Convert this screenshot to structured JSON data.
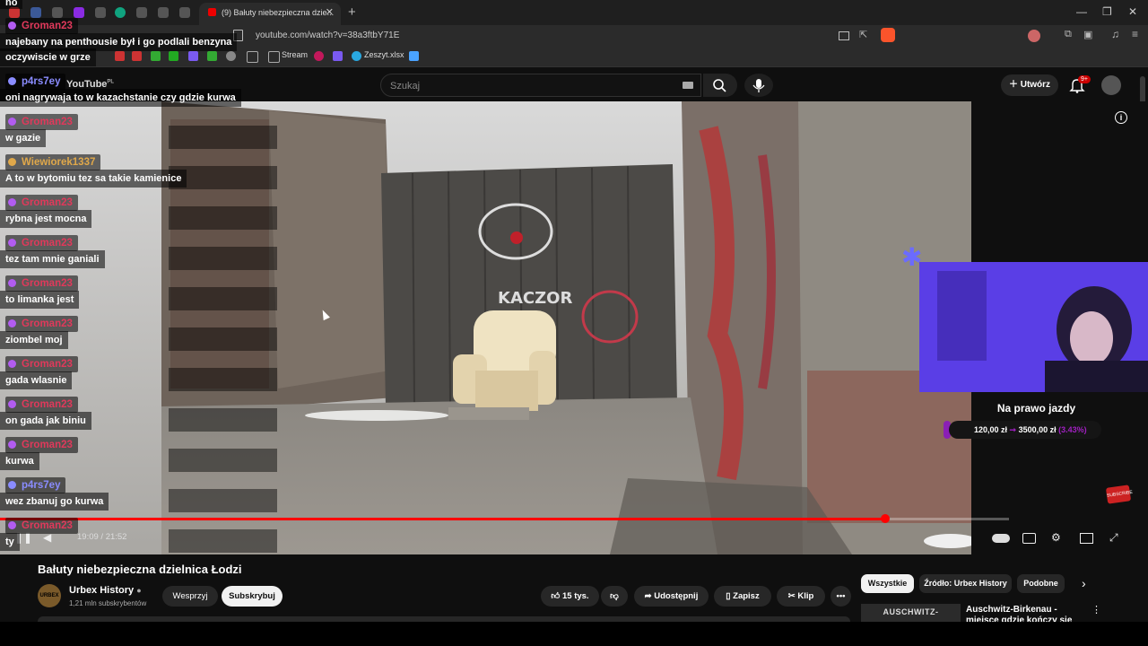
{
  "browser": {
    "active_tab_title": "(9) Bałuty niebezpieczna dzie...",
    "url": "youtube.com/watch?v=38a3ftbY71E",
    "bookmarks": [
      "Stream",
      "Zeszyt.xlsx"
    ]
  },
  "youtube": {
    "logo_text": "YouTube",
    "logo_region": "PL",
    "search_placeholder": "Szukaj",
    "create_label": "Utwórz",
    "notif_count": "9+"
  },
  "chat": {
    "top_fragment": "no",
    "messages": [
      {
        "user": "Groman23",
        "text": "najebany na penthousie był i go podlali benzyna",
        "user_color": "#e0395b"
      },
      {
        "user": "",
        "text": "oczywiscie w grze",
        "user_color": ""
      },
      {
        "user": "p4rs7ey",
        "text": "oni nagrywaja to w kazachstanie czy gdzie kurwa",
        "user_color": "#8a8cff"
      },
      {
        "user": "Groman23",
        "text": "w gazie",
        "user_color": "#e0395b"
      },
      {
        "user": "Wiewiorek1337",
        "text": "A to w bytomiu tez sa takie kamienice",
        "user_color": "#e0a84a"
      },
      {
        "user": "Groman23",
        "text": "rybna jest mocna",
        "user_color": "#e0395b"
      },
      {
        "user": "Groman23",
        "text": "tez tam mnie ganiali",
        "user_color": "#e0395b"
      },
      {
        "user": "Groman23",
        "text": "to limanka jest",
        "user_color": "#e0395b"
      },
      {
        "user": "Groman23",
        "text": "ziombel moj",
        "user_color": "#e0395b"
      },
      {
        "user": "Groman23",
        "text": "gada wlasnie",
        "user_color": "#e0395b"
      },
      {
        "user": "Groman23",
        "text": "on gada jak biniu",
        "user_color": "#e0395b"
      },
      {
        "user": "Groman23",
        "text": "kurwa",
        "user_color": "#e0395b"
      },
      {
        "user": "p4rs7ey",
        "text": "wez zbanuj go kurwa",
        "user_color": "#8a8cff"
      },
      {
        "user": "Groman23",
        "text": "ty",
        "user_color": "#e0395b"
      }
    ]
  },
  "player": {
    "time": "19:09 / 21:52",
    "progress": 0.877
  },
  "overlay": {
    "goal_title": "Na prawo jazdy",
    "goal_current": "120,00 zł",
    "goal_target": "3500,00 zł",
    "goal_percent": "(3.43%)",
    "goal_fraction": 0.0343,
    "subscribe_sticker": "SUBSCRIBE"
  },
  "video_info": {
    "title": "Bałuty niebezpieczna dzielnica Łodzi",
    "channel": "Urbex History",
    "channel_avatar_text": "URBEX",
    "subscribers": "1,21 mln subskrybentów",
    "support_label": "Wesprzyj",
    "subscribe_label": "Subskrybuj",
    "likes": "15 tys.",
    "share_label": "Udostępnij",
    "save_label": "Zapisz",
    "clip_label": "Klip"
  },
  "recommendations": {
    "chips": [
      "Wszystkie",
      "Źródło: Urbex History",
      "Podobne"
    ],
    "first_thumb_text": "AUSCHWITZ-BIRKENAU",
    "first_title": "Auschwitz-Birkenau - miejsce gdzie kończy się"
  },
  "colors": {
    "accent_red": "#ff0000",
    "goal_purple": "#a020c0",
    "webcam_bg": "#5a3ee6"
  }
}
